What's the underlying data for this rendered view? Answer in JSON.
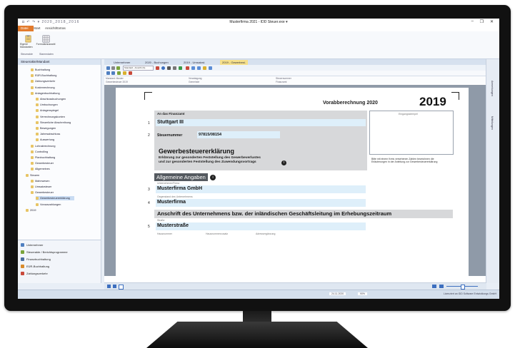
{
  "window": {
    "title": "Musterfirma 2021 - IDD Steuer.exe ▾",
    "qat_path": "2020_2018_2016",
    "minimize": "–",
    "restore": "❐",
    "close": "✕"
  },
  "ribbon": {
    "file_tab": "Datei",
    "tabs": [
      "Start",
      "Ansicht/Extras"
    ],
    "buttons": [
      {
        "label": "Eigene Mandanten",
        "icon": "clipboard-icon"
      },
      {
        "label": "Formularauswahl",
        "icon": "grid-icon"
      }
    ],
    "groups": [
      "Steuerakte",
      "Stammdaten"
    ]
  },
  "sidebar": {
    "header": "Steuerakte/Mandant",
    "tree": [
      {
        "label": "Buchhaltung",
        "indent": 2
      },
      {
        "label": "EÜR-Buchhaltung",
        "indent": 2
      },
      {
        "label": "Zahlungsverkehr",
        "indent": 2
      },
      {
        "label": "Kostenrechnung",
        "indent": 2
      },
      {
        "label": "Anlagenbuchhaltung",
        "indent": 2
      },
      {
        "label": "Abschlussbuchungen",
        "indent": 3
      },
      {
        "label": "Umbuchungen",
        "indent": 3
      },
      {
        "label": "Anlagenspiegel",
        "indent": 3
      },
      {
        "label": "Verrechnungskonten",
        "indent": 3
      },
      {
        "label": "Steuerliche Abschreibung",
        "indent": 3
      },
      {
        "label": "Bewegungen",
        "indent": 3
      },
      {
        "label": "Jahresabschluss",
        "indent": 3
      },
      {
        "label": "Auswertung",
        "indent": 3
      },
      {
        "label": "Lohnabrechnung",
        "indent": 2
      },
      {
        "label": "Controlling",
        "indent": 2
      },
      {
        "label": "Planbuchhaltung",
        "indent": 2
      },
      {
        "label": "Gewerbesteuer",
        "indent": 2
      },
      {
        "label": "Allgemeines",
        "indent": 2
      },
      {
        "label": "Steuern",
        "indent": 1
      },
      {
        "label": "Mahnwesen",
        "indent": 2
      },
      {
        "label": "Umsatzsteuer",
        "indent": 2
      },
      {
        "label": "Gewerbesteuer",
        "indent": 2
      },
      {
        "label": "Gewerbesteuererklärung",
        "indent": 3
      },
      {
        "label": "Vorauszahlungen",
        "indent": 3
      },
      {
        "label": "2019",
        "indent": 1
      }
    ],
    "nav": [
      {
        "label": "Unternehmer",
        "color": "#4f7fc0"
      },
      {
        "label": "Steuerakte / Berichtsprogramme",
        "color": "#7aa43a"
      },
      {
        "label": "Finanzbuchhaltung",
        "color": "#4b6fa0"
      },
      {
        "label": "EÜR-Buchhaltung",
        "color": "#d98b2b"
      },
      {
        "label": "Zahlungsverkehr",
        "color": "#c94a3b"
      }
    ]
  },
  "doc_tabs": [
    {
      "label": "Unternehmer",
      "active": false
    },
    {
      "label": "2020 - Buchungen",
      "active": false
    },
    {
      "label": "2019 - Umsatzst.",
      "active": false
    },
    {
      "label": "2019 - Gewerbest.",
      "active": true
    }
  ],
  "toolbar": {
    "zoom_select": "Standard - Ansicht (S)"
  },
  "field_row": {
    "labels": [
      "Mandant: Muster",
      "Veranlagung",
      "Steuernummer",
      "Gewerbesteuer 2019",
      "Gemeinde",
      "Finanzamt"
    ]
  },
  "form": {
    "heading": "Vorabberechnung 2020",
    "year": "2019",
    "finanzamt_label": "An das Finanzamt",
    "stamp_label": "Eingangsstempel",
    "line1_number": "1",
    "line1_value": "Stuttgart III",
    "line2_number": "2",
    "steuernummer_label": "Steuernummer",
    "steuernummer_value": "97815/08154",
    "title": "Gewerbesteuererklärung",
    "subtitle_line1": "Erklärung zur gesonderten Feststellung des Gewerbeverlustes",
    "subtitle_line2": "und zur gesonderten Feststellung des Zuwendungsvortrags",
    "side_note": "Bitte mit einem Kreis versehenen Zahlen bezeichnen die Erläuterungen in der Anleitung zur Gewerbesteuererklärung",
    "section_label": "Allgemeine Angaben",
    "info_icon": "i",
    "line3_caption": "Unternehmen/Firma",
    "line3_number": "3",
    "line3_value": "Musterfirma GmbH",
    "line4_caption": "Gegenstand des Unternehmens",
    "line4_number": "4",
    "line4_value": "Musterfirma",
    "address_heading": "Anschrift des Unternehmens bzw. der inländischen Geschäftsleitung im Erhebungszeitraum",
    "line5_caption": "Straße",
    "line5_number": "5",
    "line5_value": "Musterstraße",
    "line6_captions": [
      "Hausnummer",
      "Hausnummerzusatz",
      "Adressergänzung"
    ]
  },
  "statusbar": {
    "date": "24.11.2020",
    "zoom": "90%"
  },
  "right_panel": {
    "tabs": [
      "Anmerkungen",
      "Mitteilungen"
    ]
  },
  "footer": {
    "text": "Lizenziert an IDD Software Entwicklungs GmbH"
  },
  "colors": {
    "accent_file_tab": "#e27a2c",
    "field_blue": "#deeffa",
    "section_dark": "#555a60",
    "active_tab": "#f6e08a"
  }
}
